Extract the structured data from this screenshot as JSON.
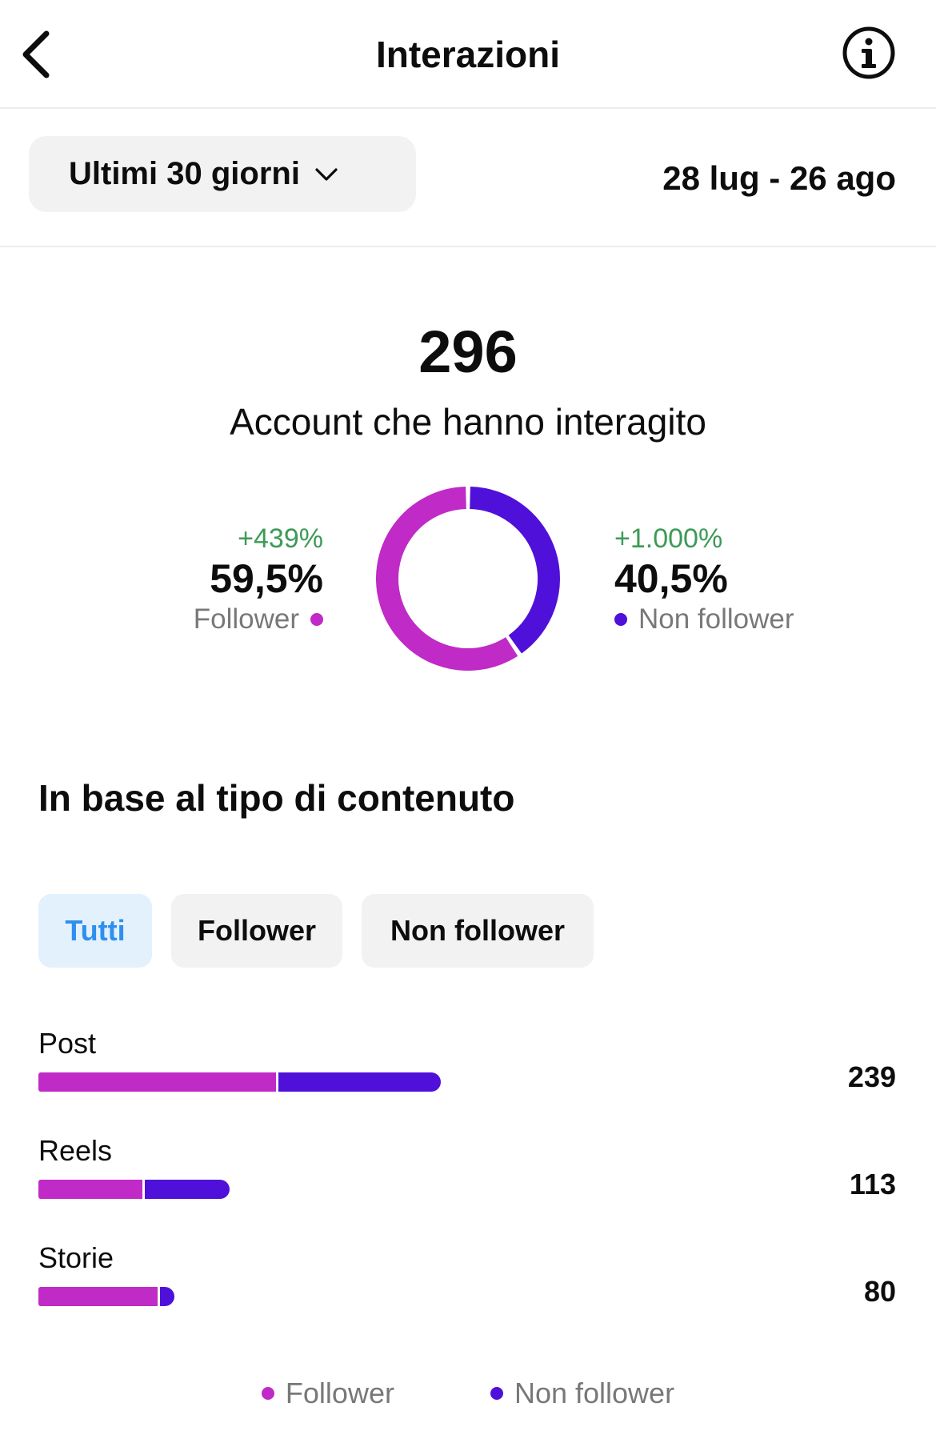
{
  "header": {
    "title": "Interazioni"
  },
  "period": {
    "label": "Ultimi 30 giorni",
    "range": "28 lug - 26 ago"
  },
  "summary": {
    "total": "296",
    "total_label": "Account che hanno interagito",
    "followers": {
      "change": "+439%",
      "percent": "59,5%",
      "label": "Follower"
    },
    "non_followers": {
      "change": "+1.000%",
      "percent": "40,5%",
      "label": "Non follower"
    }
  },
  "colors": {
    "follower": "#c02ac6",
    "non_follower": "#4f11d9",
    "positive": "#3d9a56",
    "chip_active": "#2e8ff0"
  },
  "section": {
    "title": "In base al tipo di contenuto",
    "filters": [
      "Tutti",
      "Follower",
      "Non follower"
    ],
    "active_filter": "Tutti"
  },
  "chart_data": {
    "type": "bar",
    "orientation": "horizontal-stacked",
    "categories": [
      "Post",
      "Reels",
      "Storie"
    ],
    "totals": [
      "239",
      "113",
      "80"
    ],
    "series": [
      {
        "name": "Follower",
        "values": [
          142,
          62,
          71
        ]
      },
      {
        "name": "Non follower",
        "values": [
          97,
          51,
          9
        ]
      }
    ],
    "legend": [
      "Follower",
      "Non follower"
    ],
    "legend_position": "bottom"
  },
  "donut": {
    "follower": 59.5,
    "non_follower": 40.5
  }
}
